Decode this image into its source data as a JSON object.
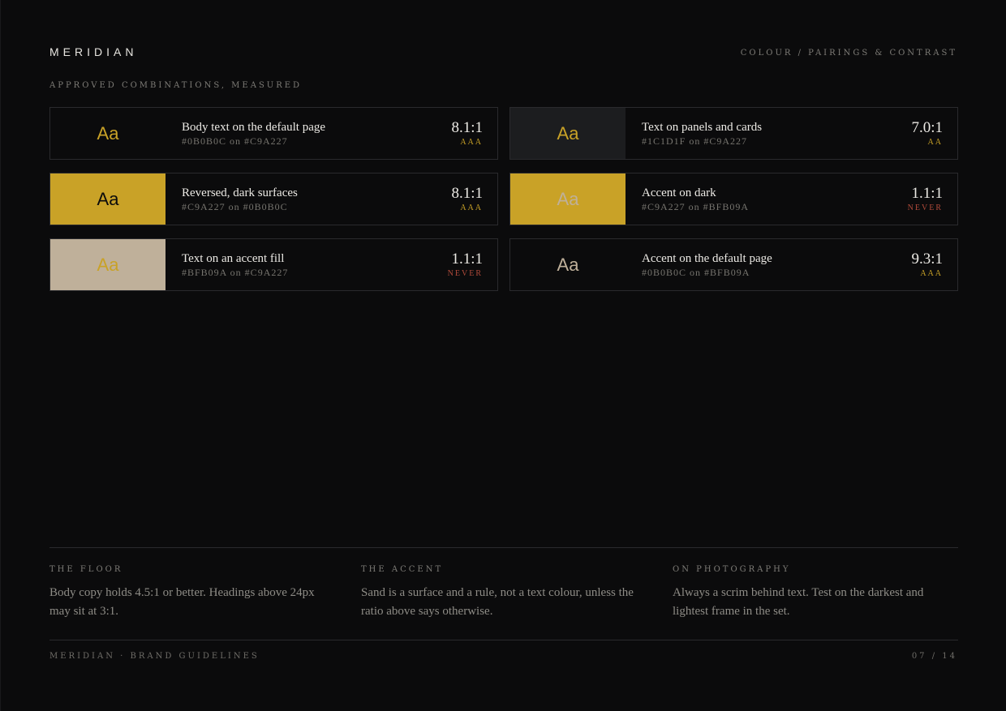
{
  "header": {
    "brand": "MERIDIAN",
    "section": "COLOUR / PAIRINGS & CONTRAST",
    "kicker": "APPROVED COMBINATIONS, MEASURED"
  },
  "colors": {
    "page": "#0B0B0C",
    "panel": "#1C1D1F",
    "accent": "#C9A227",
    "sand": "#BFB09A",
    "pass": "#C9A227",
    "fail": "#B04A3A"
  },
  "pairings": [
    {
      "sample": "Aa",
      "title": "Body text on the default page",
      "codes": "#0B0B0C on #C9A227",
      "ratio": "8.1:1",
      "grade": "AAA",
      "bg": "#0B0B0C",
      "fg": "#C9A227",
      "grade_color": "#C9A227"
    },
    {
      "sample": "Aa",
      "title": "Text on panels and cards",
      "codes": "#1C1D1F on #C9A227",
      "ratio": "7.0:1",
      "grade": "AA",
      "bg": "#1C1D1F",
      "fg": "#C9A227",
      "grade_color": "#C9A227"
    },
    {
      "sample": "Aa",
      "title": "Reversed, dark surfaces",
      "codes": "#C9A227 on #0B0B0C",
      "ratio": "8.1:1",
      "grade": "AAA",
      "bg": "#C9A227",
      "fg": "#0B0B0C",
      "grade_color": "#C9A227"
    },
    {
      "sample": "Aa",
      "title": "Accent on dark",
      "codes": "#C9A227 on #BFB09A",
      "ratio": "1.1:1",
      "grade": "NEVER",
      "bg": "#C9A227",
      "fg": "#BFB09A",
      "grade_color": "#B04A3A"
    },
    {
      "sample": "Aa",
      "title": "Text on an accent fill",
      "codes": "#BFB09A on #C9A227",
      "ratio": "1.1:1",
      "grade": "NEVER",
      "bg": "#BFB09A",
      "fg": "#C9A227",
      "grade_color": "#B04A3A"
    },
    {
      "sample": "Aa",
      "title": "Accent on the default page",
      "codes": "#0B0B0C on #BFB09A",
      "ratio": "9.3:1",
      "grade": "AAA",
      "bg": "#0B0B0C",
      "fg": "#BFB09A",
      "grade_color": "#C9A227"
    }
  ],
  "notes": [
    {
      "heading": "THE FLOOR",
      "body": "Body copy holds 4.5:1 or better. Headings above 24px may sit at 3:1."
    },
    {
      "heading": "THE ACCENT",
      "body": "Sand is a surface and a rule, not a text colour, unless the ratio above says otherwise."
    },
    {
      "heading": "ON PHOTOGRAPHY",
      "body": "Always a scrim behind text. Test on the darkest and lightest frame in the set."
    }
  ],
  "footer": {
    "left": "MERIDIAN · BRAND GUIDELINES",
    "right": "07 / 14"
  }
}
